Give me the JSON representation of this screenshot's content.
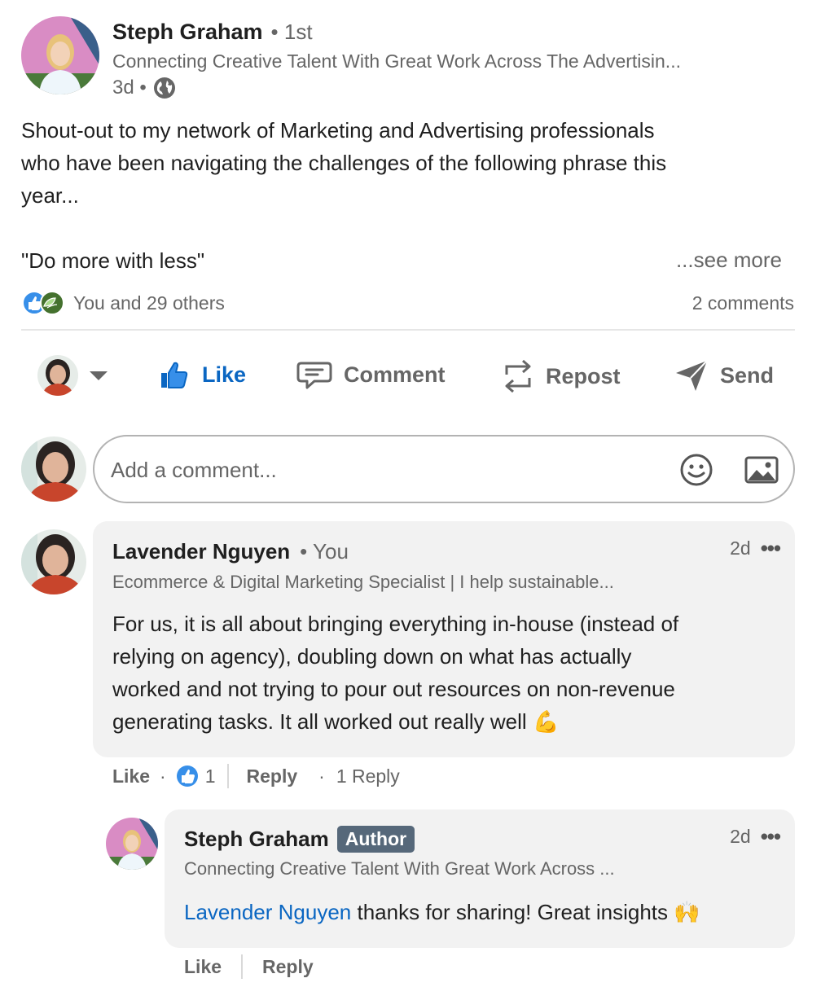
{
  "post": {
    "author": {
      "name": "Steph Graham",
      "degree": "• 1st",
      "headline": "Connecting Creative Talent With Great Work Across The Advertisin...",
      "time": "3d •"
    },
    "text_lines": [
      "Shout-out to my network of Marketing and Advertising professionals",
      "who have been navigating the challenges of the following phrase this",
      "year..."
    ],
    "quote": "\"Do more with less\"",
    "see_more": "...see more",
    "reactions_text": "You and 29 others",
    "comments_count": "2 comments"
  },
  "actions": {
    "like": "Like",
    "comment": "Comment",
    "repost": "Repost",
    "send": "Send"
  },
  "comment_input": {
    "placeholder": "Add a comment..."
  },
  "comments": [
    {
      "name": "Lavender Nguyen",
      "relation": "• You",
      "headline": "Ecommerce & Digital Marketing Specialist | I help sustainable...",
      "time": "2d",
      "text_lines": [
        "For us, it is all about bringing everything in-house (instead of",
        "relying on agency), doubling down on what has actually",
        "worked and not trying to pour out resources on non-revenue",
        "generating tasks. It all worked out really well"
      ],
      "emoji": "💪",
      "like_label": "Like",
      "reaction_count": "1",
      "reply_label": "Reply",
      "replies_label": "1 Reply"
    }
  ],
  "reply": {
    "name": "Steph Graham",
    "badge": "Author",
    "headline": "Connecting Creative Talent With Great Work Across ...",
    "time": "2d",
    "mention": "Lavender Nguyen",
    "text": " thanks for sharing! Great insights",
    "emoji": "🙌",
    "like_label": "Like",
    "reply_label": "Reply"
  },
  "colors": {
    "brand_blue": "#0a66c2",
    "badge_bg": "#56687a",
    "bubble_bg": "#f2f2f2"
  },
  "icons": {
    "privacy": "globe-icon",
    "like": "thumbs-up-icon",
    "comment": "speech-bubble-icon",
    "repost": "repost-arrows-icon",
    "send": "paper-plane-icon",
    "emoji": "smiley-icon",
    "image": "image-icon",
    "more": "more-dots-icon"
  }
}
